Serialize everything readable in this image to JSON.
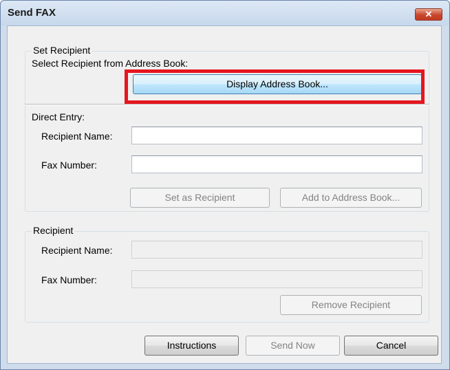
{
  "window": {
    "title": "Send FAX",
    "close_glyph": "✕"
  },
  "set_recipient": {
    "group_label": "Set Recipient",
    "address_book_caption": "Select Recipient from Address Book:",
    "display_address_book_label": "Display Address Book..."
  },
  "direct_entry": {
    "label": "Direct Entry:",
    "recipient_name_label": "Recipient Name:",
    "recipient_name_value": "",
    "fax_number_label": "Fax Number:",
    "fax_number_value": "",
    "set_as_recipient_label": "Set as Recipient",
    "add_to_address_book_label": "Add to Address Book..."
  },
  "recipient": {
    "group_label": "Recipient",
    "recipient_name_label": "Recipient Name:",
    "recipient_name_value": "",
    "fax_number_label": "Fax Number:",
    "fax_number_value": "",
    "remove_recipient_label": "Remove Recipient"
  },
  "footer": {
    "instructions_label": "Instructions",
    "send_now_label": "Send Now",
    "cancel_label": "Cancel"
  },
  "colors": {
    "highlight": "#e5161f",
    "accent": "#3c7fb1"
  }
}
